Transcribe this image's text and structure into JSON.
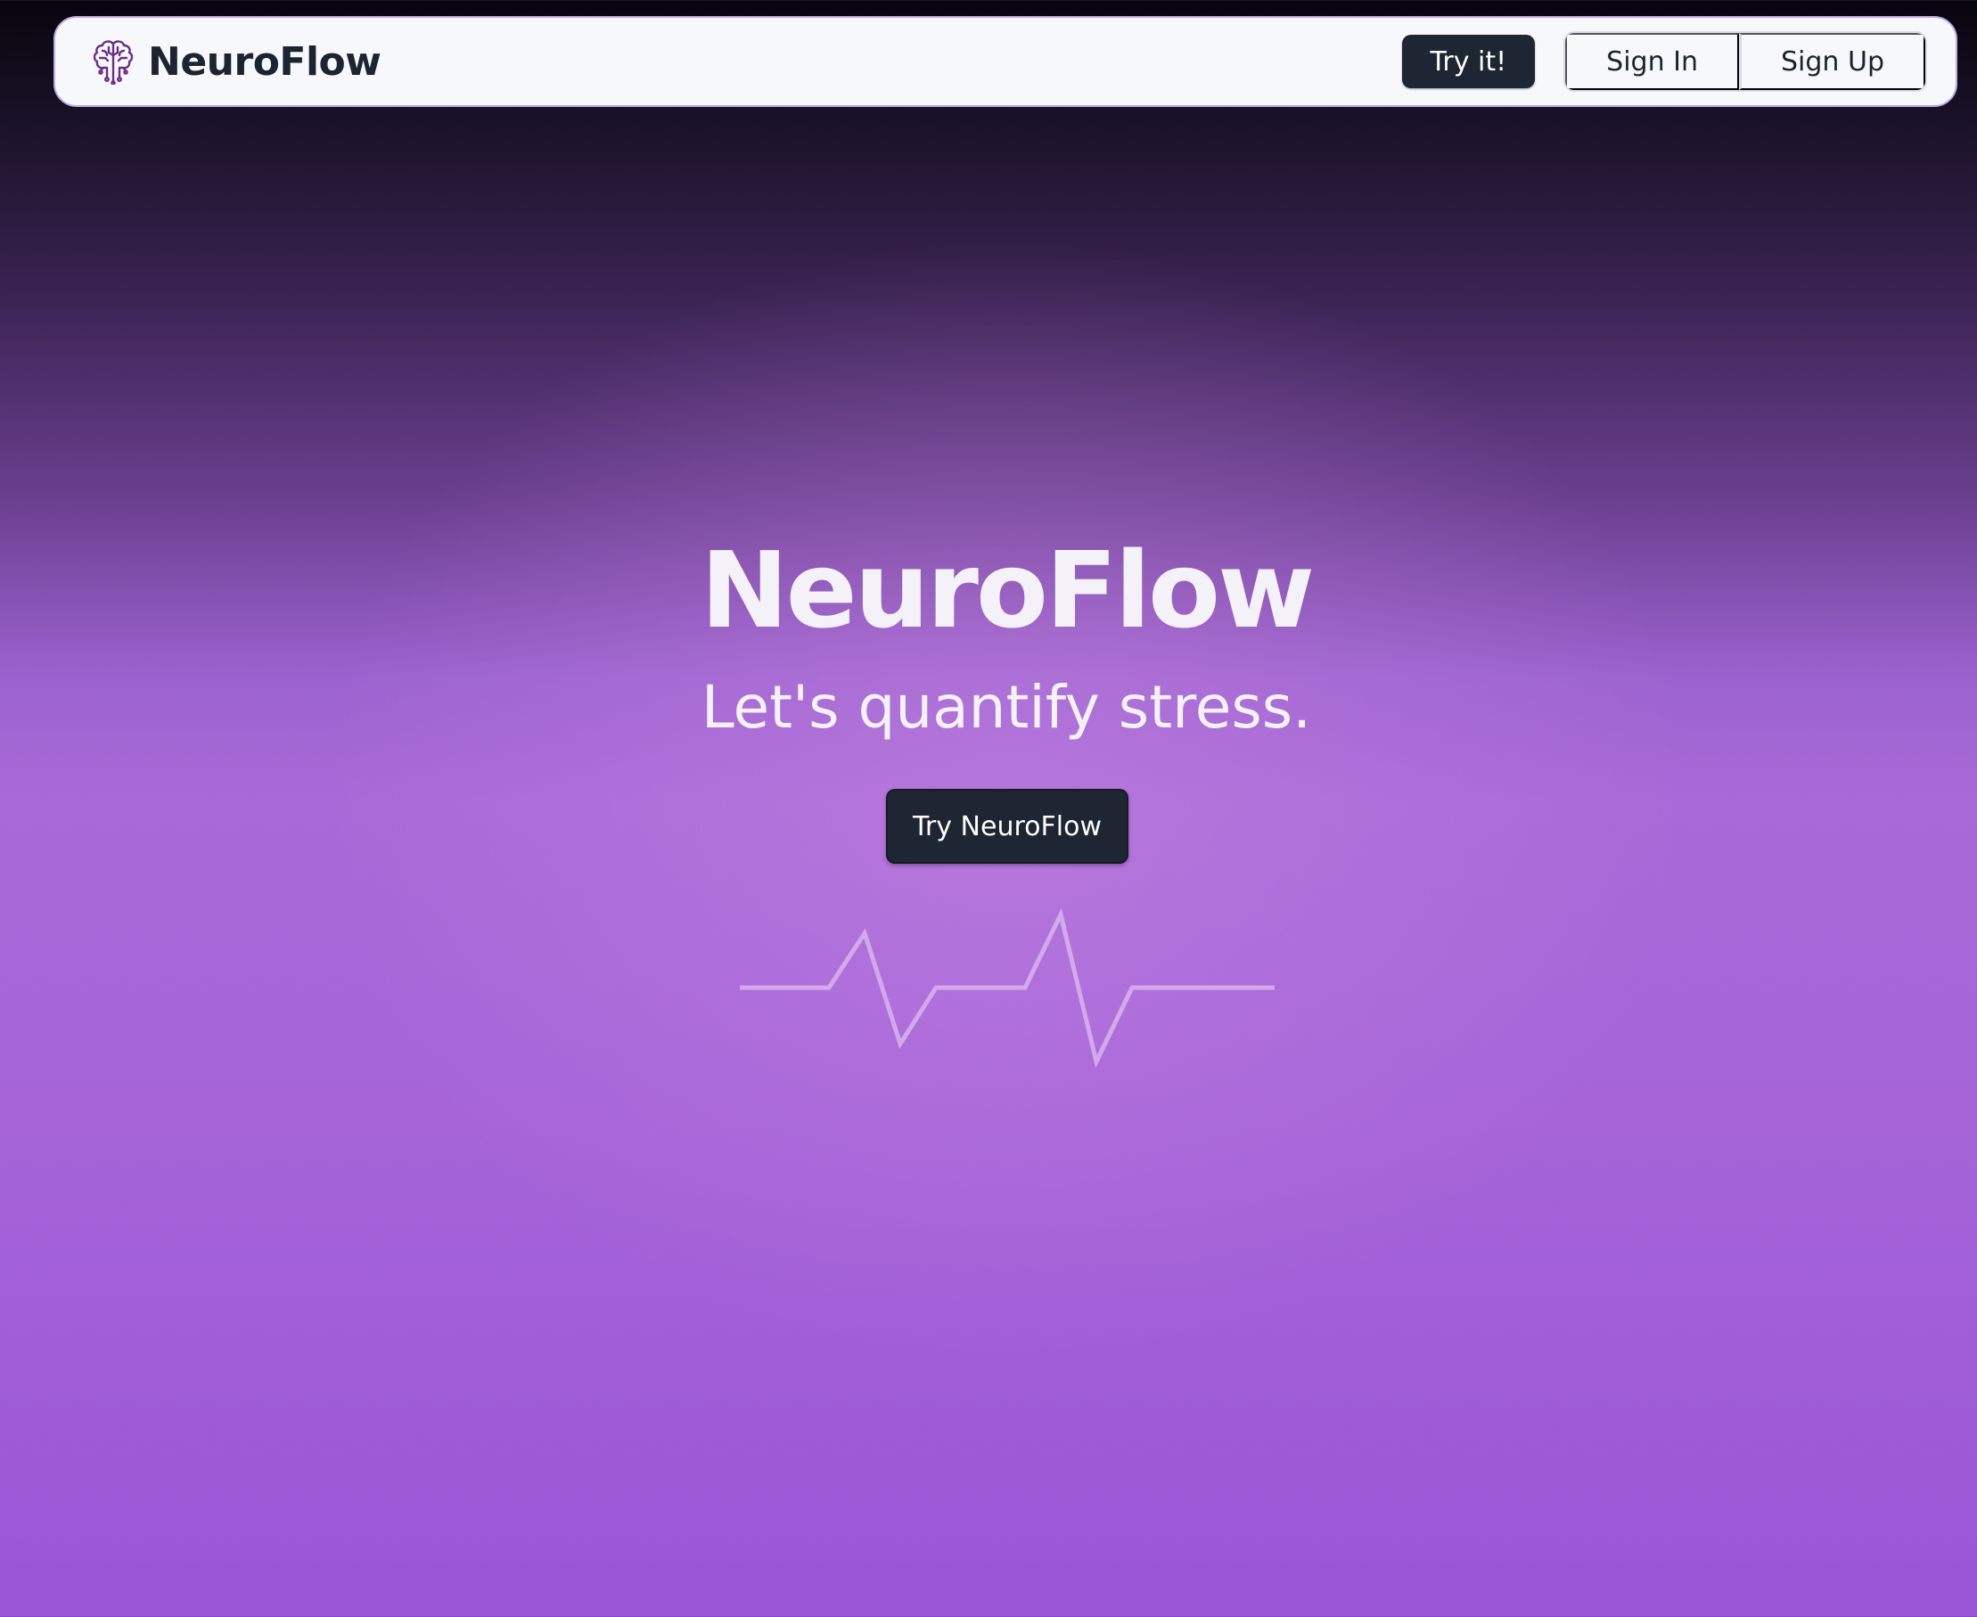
{
  "navbar": {
    "brand_name": "NeuroFlow",
    "brand_icon": "brain-circuit-icon",
    "try_label": "Try it!",
    "sign_in_label": "Sign In",
    "sign_up_label": "Sign Up"
  },
  "hero": {
    "title": "NeuroFlow",
    "subtitle": "Let's quantify stress.",
    "cta_label": "Try NeuroFlow",
    "decoration_icon": "heartbeat-pulse-line"
  },
  "colors": {
    "navbar_bg": "#f7f8fb",
    "navbar_border": "#b9a9e6",
    "button_dark": "#1e2533",
    "text_dark": "#1c2331",
    "hero_text": "#f4f1f8",
    "background_top": "#07050d",
    "background_purple": "#a86ad8",
    "brand_icon_color": "#6b2f86"
  }
}
